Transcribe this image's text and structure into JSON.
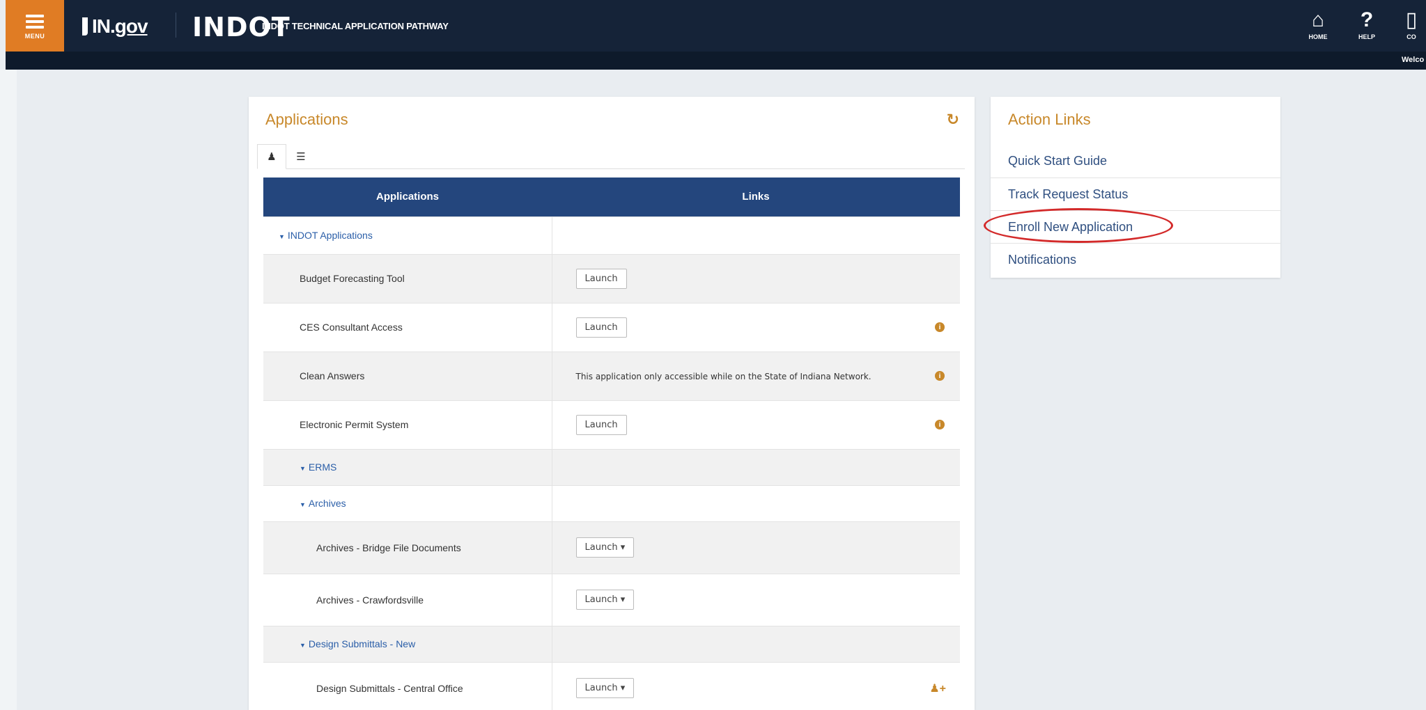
{
  "header": {
    "menu_label": "MENU",
    "brand_in": "IN.",
    "brand_gov": "gov",
    "indot_logo": "INDOT",
    "app_title": "INDOT TECHNICAL APPLICATION PATHWAY",
    "nav": [
      {
        "label": "HOME",
        "glyph": "⌂"
      },
      {
        "label": "HELP",
        "glyph": "?"
      },
      {
        "label": "CO",
        "glyph": "▯"
      }
    ],
    "welcome": "Welco"
  },
  "applications_panel": {
    "title": "Applications",
    "tabs": [
      {
        "icon": "person-icon",
        "glyph": "♟"
      },
      {
        "icon": "list-icon",
        "glyph": "☰"
      }
    ],
    "columns": [
      "Applications",
      "Links"
    ],
    "rows": [
      {
        "type": "group",
        "label": "INDOT Applications",
        "level": 0,
        "shade": "w"
      },
      {
        "type": "app",
        "label": "Budget Forecasting Tool",
        "level": 1,
        "link": "Launch",
        "shade": "g",
        "icon": ""
      },
      {
        "type": "app",
        "label": "CES Consultant Access",
        "level": 1,
        "link": "Launch",
        "shade": "w",
        "icon": "info-icon"
      },
      {
        "type": "app",
        "label": "Clean Answers",
        "level": 1,
        "note": "This application only accessible while on the State of Indiana Network.",
        "shade": "g",
        "icon": "info-icon"
      },
      {
        "type": "app",
        "label": "Electronic Permit System",
        "level": 1,
        "link": "Launch",
        "shade": "w",
        "icon": "info-icon"
      },
      {
        "type": "group",
        "label": "ERMS",
        "level": 1,
        "shade": "g"
      },
      {
        "type": "group",
        "label": "Archives",
        "level": 2,
        "shade": "w"
      },
      {
        "type": "app",
        "label": "Archives - Bridge File Documents",
        "level": 3,
        "link": "Launch ▾",
        "shade": "g",
        "icon": ""
      },
      {
        "type": "app",
        "label": "Archives - Crawfordsville",
        "level": 3,
        "link": "Launch ▾",
        "shade": "w",
        "icon": ""
      },
      {
        "type": "group",
        "label": "Design Submittals - New",
        "level": 2,
        "shade": "g"
      },
      {
        "type": "app",
        "label": "Design Submittals - Central Office",
        "level": 3,
        "link": "Launch ▾",
        "shade": "w",
        "icon": "user-add-icon"
      }
    ]
  },
  "action_links": {
    "title": "Action Links",
    "items": [
      "Quick Start Guide",
      "Track Request Status",
      "Enroll New Application",
      "Notifications"
    ],
    "highlighted": "Enroll New Application",
    "highlight_color": "#d32a2a"
  },
  "colors": {
    "topbar": "#152338",
    "menu_accent": "#e07c24",
    "table_header": "#24467d",
    "title_gold": "#c8882a",
    "link_blue": "#2f4f80"
  }
}
